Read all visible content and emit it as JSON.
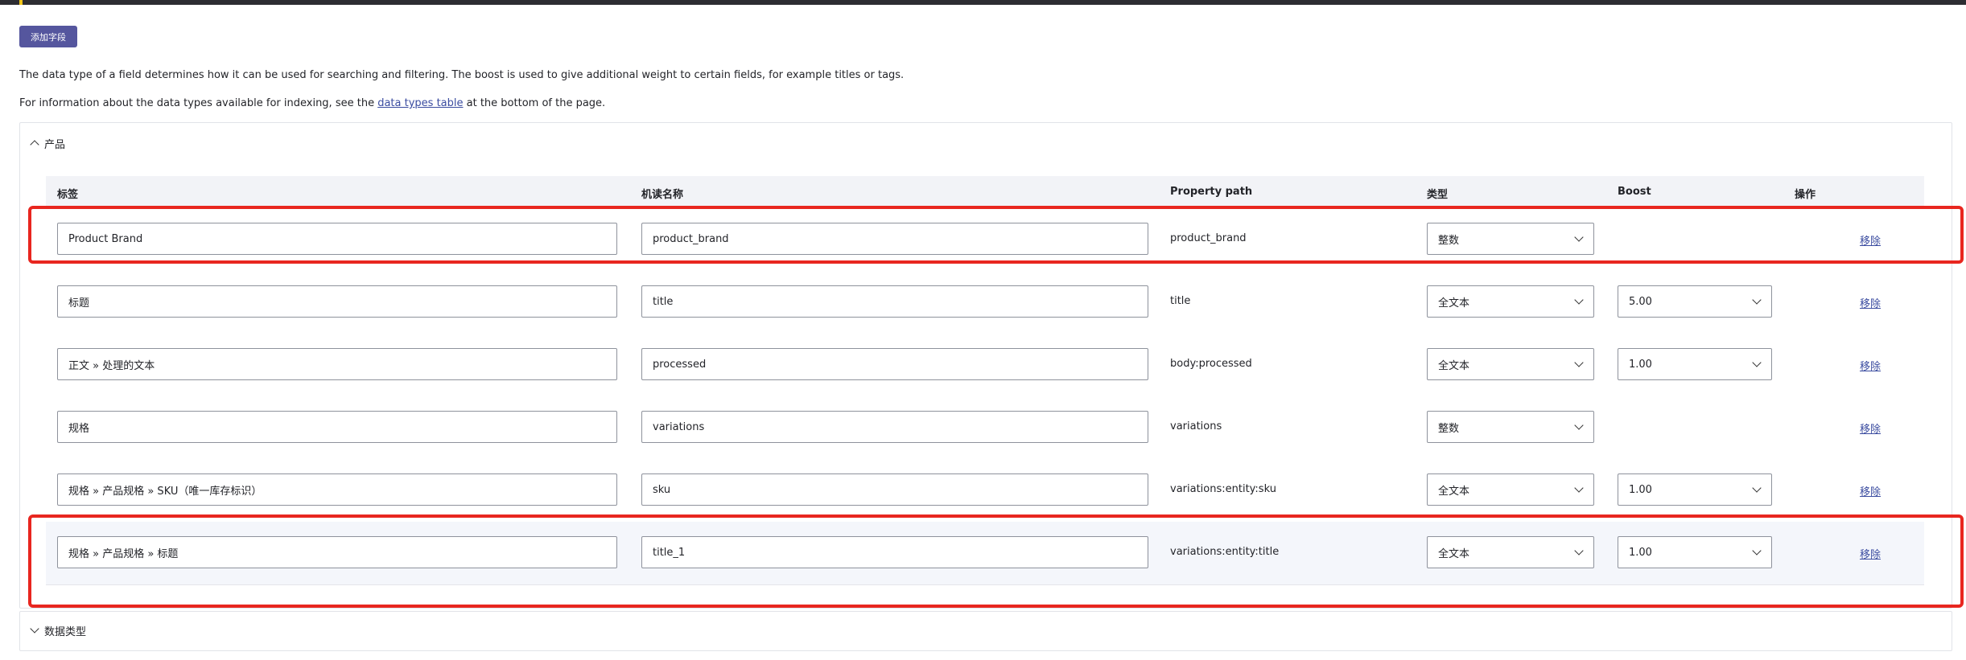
{
  "buttons": {
    "add_field": "添加字段"
  },
  "description": {
    "line1": "The data type of a field determines how it can be used for searching and filtering. The boost is used to give additional weight to certain fields, for example titles or tags.",
    "line2_before": "For information about the data types available for indexing, see the ",
    "line2_link": "data types table",
    "line2_after": " at the bottom of the page."
  },
  "section": {
    "title": "产品",
    "columns": {
      "label": "标签",
      "machine_name": "机读名称",
      "property_path": "Property path",
      "type": "类型",
      "boost": "Boost",
      "operations": "操作"
    },
    "rows": [
      {
        "label": "Product Brand",
        "machine_name": "product_brand",
        "property_path": "product_brand",
        "type": "整数",
        "boost": null,
        "remove": "移除"
      },
      {
        "label": "标题",
        "machine_name": "title",
        "property_path": "title",
        "type": "全文本",
        "boost": "5.00",
        "remove": "移除"
      },
      {
        "label": "正文 » 处理的文本",
        "machine_name": "processed",
        "property_path": "body:processed",
        "type": "全文本",
        "boost": "1.00",
        "remove": "移除"
      },
      {
        "label": "规格",
        "machine_name": "variations",
        "property_path": "variations",
        "type": "整数",
        "boost": null,
        "remove": "移除"
      },
      {
        "label": "规格 » 产品规格 » SKU（唯一库存标识）",
        "machine_name": "sku",
        "property_path": "variations:entity:sku",
        "type": "全文本",
        "boost": "1.00",
        "remove": "移除"
      },
      {
        "label": "规格 » 产品规格 » 标题",
        "machine_name": "title_1",
        "property_path": "variations:entity:title",
        "type": "全文本",
        "boost": "1.00",
        "remove": "移除"
      }
    ]
  },
  "section2": {
    "title": "数据类型"
  },
  "colors": {
    "accent": "#55569e",
    "highlight_border": "#e8261f",
    "link": "#3b4ca0"
  }
}
